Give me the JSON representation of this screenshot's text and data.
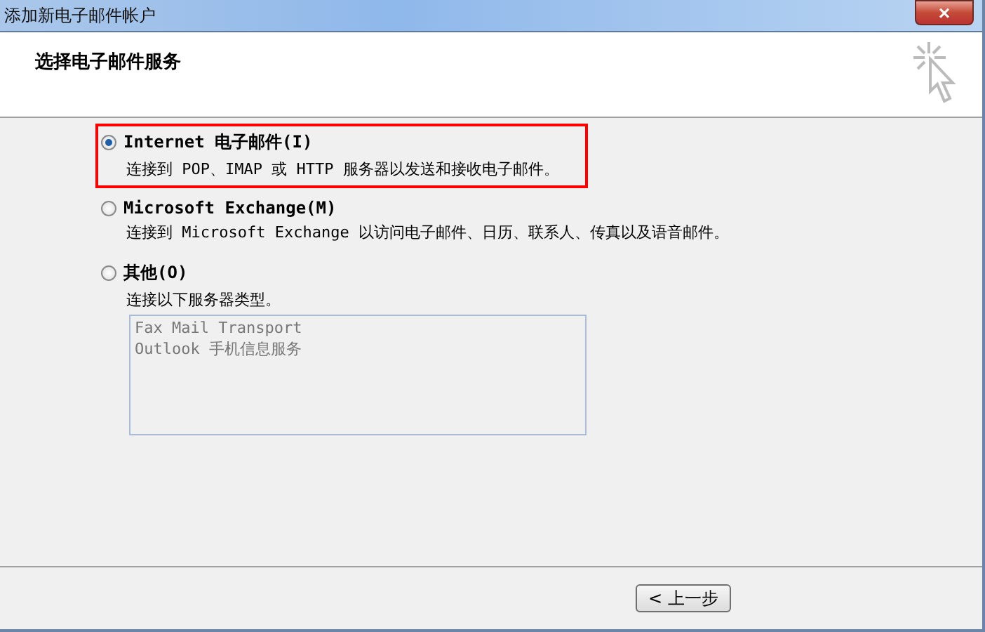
{
  "window": {
    "title": "添加新电子邮件帐户",
    "close": "×"
  },
  "header": {
    "title": "选择电子邮件服务"
  },
  "options": [
    {
      "label": "Internet 电子邮件(I)",
      "description": "连接到 POP、IMAP 或 HTTP 服务器以发送和接收电子邮件。",
      "selected": true,
      "highlighted": true
    },
    {
      "label": "Microsoft Exchange(M)",
      "description": "连接到 Microsoft Exchange 以访问电子邮件、日历、联系人、传真以及语音邮件。",
      "selected": false,
      "highlighted": false
    },
    {
      "label": "其他(O)",
      "description": "连接以下服务器类型。",
      "selected": false,
      "highlighted": false,
      "list": {
        "disabled": true,
        "items": [
          "Fax Mail Transport",
          "Outlook 手机信息服务"
        ]
      }
    }
  ],
  "buttons": [
    "< 上一步"
  ]
}
